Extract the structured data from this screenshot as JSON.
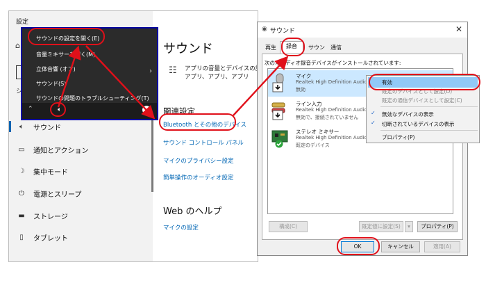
{
  "settings": {
    "title": "設定",
    "main_title": "サウンド",
    "volume_text_1": "アプリの音量とデバイスの設定",
    "volume_text_2": "アプリ、アプリ、アプリ",
    "related_title": "関連設定",
    "links": [
      "Bluetooth とその他のデバイス",
      "サウンド コントロール パネル",
      "マイクのプライバシー設定",
      "簡単操作のオーディオ設定"
    ],
    "web_help_title": "Web のヘルプ",
    "web_help_link": "マイクの設定",
    "sidebar": [
      {
        "icon": "speaker-icon",
        "label": "サウンド"
      },
      {
        "icon": "notification-icon",
        "label": "通知とアクション"
      },
      {
        "icon": "focus-assist-icon",
        "label": "集中モード"
      },
      {
        "icon": "power-icon",
        "label": "電源とスリープ"
      },
      {
        "icon": "storage-icon",
        "label": "ストレージ"
      },
      {
        "icon": "tablet-icon",
        "label": "タブレット"
      }
    ],
    "clipped_labels": [
      "シ"
    ]
  },
  "context_menu": {
    "items": [
      "サウンドの設定を開く(E)",
      "音量ミキサーを開く(M)",
      "立体音響 (オフ)",
      "サウンド(S)",
      "サウンドの問題のトラブルシューティング(T)"
    ]
  },
  "dialog": {
    "title": "サウンド",
    "tabs": [
      "再生",
      "録音",
      "サウンド",
      "通信"
    ],
    "selected_tab": "録音",
    "panel_label": "次のオーディオ録音デバイスがインストールされています:",
    "devices": [
      {
        "name": "マイク",
        "driver": "Realtek High Definition Audio",
        "status": "無効"
      },
      {
        "name": "ライン入力",
        "driver": "Realtek High Definition Audio",
        "status": "無効で、接続されていません"
      },
      {
        "name": "ステレオ ミキサー",
        "driver": "Realtek High Definition Audio",
        "status": "既定のデバイス"
      }
    ],
    "buttons": {
      "configure": "構成(C)",
      "set_default": "既定値に設定(S)",
      "properties": "プロパティ(P)",
      "ok": "OK",
      "cancel": "キャンセル",
      "apply": "適用(A)"
    }
  },
  "dropdown": {
    "items": [
      {
        "label": "有効",
        "highlighted": true
      },
      {
        "label": "既定のデバイスとして設定(D)",
        "disabled": true
      },
      {
        "label": "既定の通信デバイスとして設定(C)",
        "disabled": true
      },
      {
        "label": "無効なデバイスの表示",
        "checked": true
      },
      {
        "label": "切断されているデバイスの表示",
        "checked": true
      },
      {
        "label": "プロパティ(P)"
      }
    ]
  },
  "colors": {
    "highlight_red": "#e0101a",
    "link_blue": "#0066b4",
    "selection_blue": "#cce8ff"
  }
}
